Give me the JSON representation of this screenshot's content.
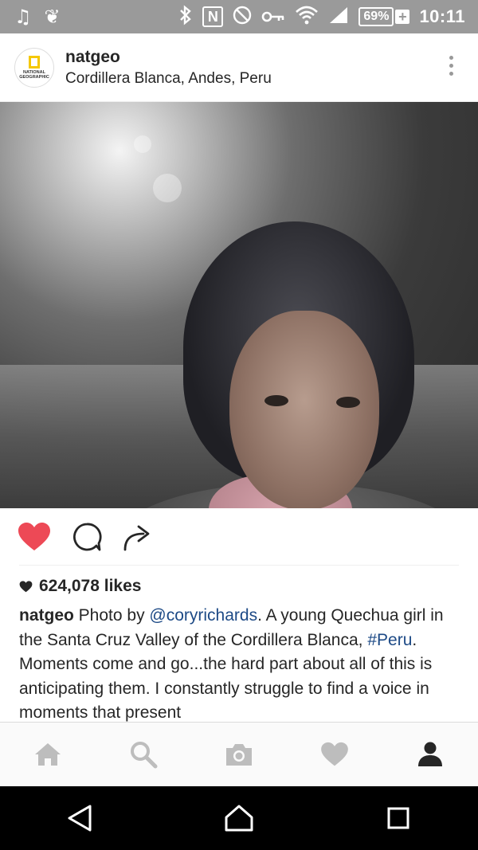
{
  "status_bar": {
    "icons": [
      "music-note-icon",
      "leaf-notification-icon",
      "bluetooth-icon",
      "nfc-icon",
      "do-not-disturb-icon",
      "vpn-key-icon",
      "wifi-icon",
      "cell-signal-icon"
    ],
    "nfc_letter": "N",
    "battery": "69%",
    "battery_plus": "+",
    "time": "10:11"
  },
  "post": {
    "avatar_brand": "NATIONAL GEOGRAPHIC",
    "username": "natgeo",
    "location": "Cordillera Blanca, Andes, Peru",
    "likes": "624,078 likes",
    "caption": {
      "user": "natgeo",
      "text_1": " Photo by ",
      "mention": "@coryrichards",
      "text_2": ". A young Quechua girl in the Santa Cruz Valley of the Cordillera Blanca, ",
      "hashtag": "#Peru",
      "text_3": ". Moments come and go...the hard part about all of this is anticipating them.  I constantly struggle to find a voice in moments that present"
    }
  },
  "actions": {
    "icons": [
      "heart-liked-icon",
      "comment-icon",
      "share-icon"
    ],
    "like_color": "#ed4956"
  },
  "bottom_nav": {
    "items": [
      "home-icon",
      "search-icon",
      "camera-icon",
      "activity-heart-icon",
      "profile-icon"
    ],
    "active": "profile-icon"
  },
  "system_nav": [
    "back-icon",
    "home-circle-icon",
    "recents-icon"
  ]
}
